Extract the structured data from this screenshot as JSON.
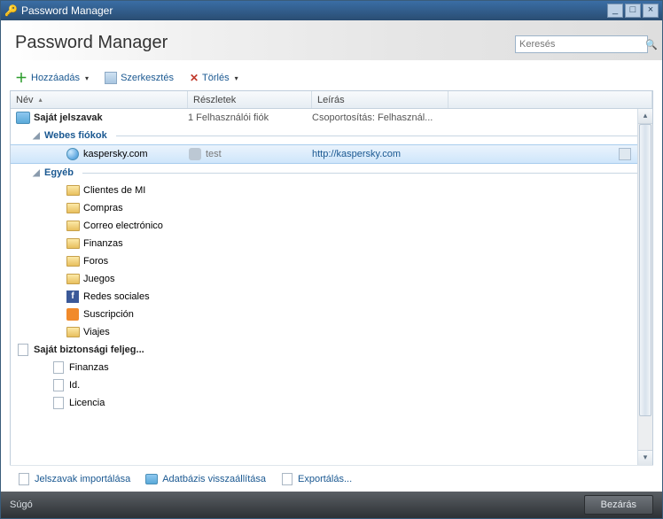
{
  "window": {
    "title": "Password Manager"
  },
  "header": {
    "heading": "Password Manager"
  },
  "search": {
    "placeholder": "Keresés"
  },
  "toolbar": {
    "add_label": "Hozzáadás",
    "edit_label": "Szerkesztés",
    "delete_label": "Törlés"
  },
  "columns": {
    "name": "Név",
    "details": "Részletek",
    "description": "Leírás"
  },
  "root": {
    "label": "Saját jelszavak",
    "details": "1 Felhasználói fiók",
    "description": "Csoportosítás: Felhasznál..."
  },
  "groups": {
    "webaccounts": {
      "label": "Webes fiókok"
    },
    "other": {
      "label": "Egyéb"
    }
  },
  "kaspersky": {
    "name": "kaspersky.com",
    "user": "test",
    "url": "http://kaspersky.com"
  },
  "other_folders": {
    "f1": "Clientes de MI",
    "f2": "Compras",
    "f3": "Correo electrónico",
    "f4": "Finanzas",
    "f5": "Foros",
    "f6": "Juegos",
    "f7": "Redes sociales",
    "f8": "Suscripción",
    "f9": "Viajes"
  },
  "safenotes": {
    "label": "Saját biztonsági feljeg...",
    "n1": "Finanzas",
    "n2": "Id.",
    "n3": "Licencia"
  },
  "bottom": {
    "import": "Jelszavak importálása",
    "restore": "Adatbázis visszaállítása",
    "export": "Exportálás..."
  },
  "footer": {
    "help": "Súgó",
    "close": "Bezárás"
  }
}
